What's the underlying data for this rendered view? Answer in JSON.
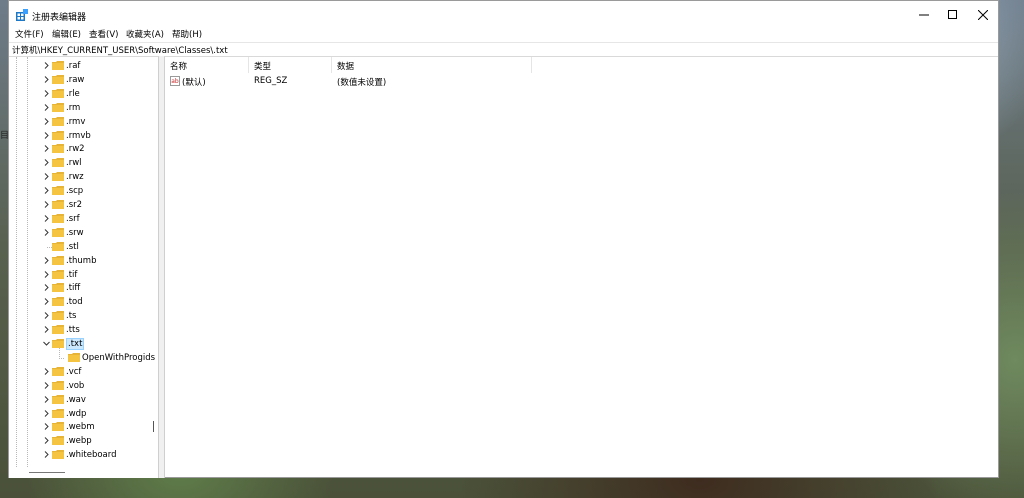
{
  "desktop": {
    "fragment": "目"
  },
  "window": {
    "title": "注册表编辑器",
    "menu": [
      "文件(F)",
      "编辑(E)",
      "查看(V)",
      "收藏夹(A)",
      "帮助(H)"
    ],
    "address": "计算机\\HKEY_CURRENT_USER\\Software\\Classes\\.txt"
  },
  "tree": {
    "items": [
      {
        "label": ".raf",
        "state": "collapsed"
      },
      {
        "label": ".raw",
        "state": "collapsed"
      },
      {
        "label": ".rle",
        "state": "collapsed"
      },
      {
        "label": ".rm",
        "state": "collapsed"
      },
      {
        "label": ".rmv",
        "state": "collapsed"
      },
      {
        "label": ".rmvb",
        "state": "collapsed"
      },
      {
        "label": ".rw2",
        "state": "collapsed"
      },
      {
        "label": ".rwl",
        "state": "collapsed"
      },
      {
        "label": ".rwz",
        "state": "collapsed"
      },
      {
        "label": ".scp",
        "state": "collapsed"
      },
      {
        "label": ".sr2",
        "state": "collapsed"
      },
      {
        "label": ".srf",
        "state": "collapsed"
      },
      {
        "label": ".srw",
        "state": "collapsed"
      },
      {
        "label": ".stl",
        "state": "leaf"
      },
      {
        "label": ".thumb",
        "state": "collapsed"
      },
      {
        "label": ".tif",
        "state": "collapsed"
      },
      {
        "label": ".tiff",
        "state": "collapsed"
      },
      {
        "label": ".tod",
        "state": "collapsed"
      },
      {
        "label": ".ts",
        "state": "collapsed"
      },
      {
        "label": ".tts",
        "state": "collapsed"
      },
      {
        "label": ".txt",
        "state": "expanded",
        "selected": true
      },
      {
        "label": "OpenWithProgids",
        "state": "child"
      },
      {
        "label": ".vcf",
        "state": "collapsed"
      },
      {
        "label": ".vob",
        "state": "collapsed"
      },
      {
        "label": ".wav",
        "state": "collapsed"
      },
      {
        "label": ".wdp",
        "state": "collapsed"
      },
      {
        "label": ".webm",
        "state": "collapsed"
      },
      {
        "label": ".webp",
        "state": "collapsed"
      },
      {
        "label": ".whiteboard",
        "state": "collapsed"
      }
    ]
  },
  "list": {
    "columns": [
      "名称",
      "类型",
      "数据"
    ],
    "rows": [
      {
        "icon": "string-value-icon",
        "name": "(默认)",
        "type": "REG_SZ",
        "data": "(数值未设置)"
      }
    ]
  },
  "colors": {
    "selection": "#cce8ff",
    "folder": "#f5c542",
    "accent": "#0078d4"
  }
}
